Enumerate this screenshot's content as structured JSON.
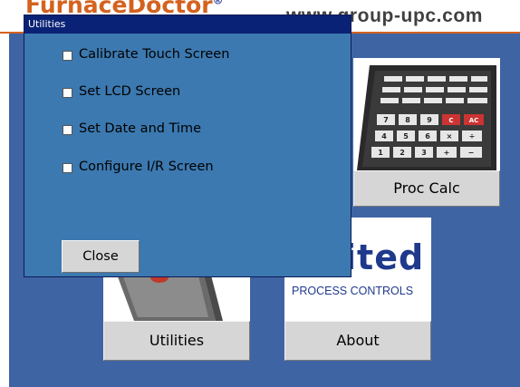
{
  "header": {
    "brand": "FurnaceDoctor",
    "brand_mark": "®",
    "website": "www.group-upc.com"
  },
  "tiles": {
    "proc_calc_label": "Proc Calc",
    "utilities_label": "Utilities",
    "about_label": "About"
  },
  "logo": {
    "word": "ited",
    "subtitle": "PROCESS CONTROLS"
  },
  "dialog": {
    "title": "Utilities",
    "options": [
      {
        "label": "Calibrate Touch Screen",
        "checked": false
      },
      {
        "label": "Set LCD Screen",
        "checked": false
      },
      {
        "label": "Set Date and Time",
        "checked": false
      },
      {
        "label": "Configure I/R Screen",
        "checked": false
      }
    ],
    "close_label": "Close"
  },
  "calculator": {
    "keys_row3": [
      "7",
      "8",
      "9",
      "C",
      "AC"
    ],
    "keys_row4": [
      "4",
      "5",
      "6",
      "×",
      "÷"
    ],
    "keys_row5": [
      "1",
      "2",
      "3",
      "+",
      "−"
    ]
  },
  "colors": {
    "brand_orange": "#d4621e",
    "background_blue": "#3f64a3",
    "dialog_blue": "#3c79b0",
    "title_bar": "#0a2275",
    "button_gray": "#d6d6d6"
  }
}
